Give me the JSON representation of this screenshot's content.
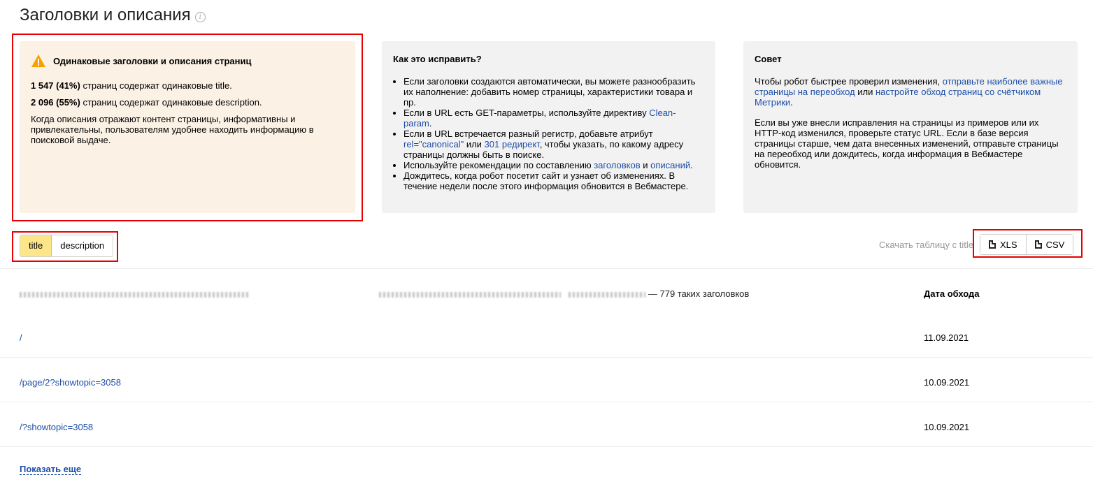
{
  "page": {
    "title": "Заголовки и описания",
    "info_icon": "info-icon"
  },
  "warning_card": {
    "heading": "Одинаковые заголовки и описания страниц",
    "stat1_bold": "1 547 (41%)",
    "stat1_text": " страниц содержат одинаковые title.",
    "stat2_bold": "2 096 (55%)",
    "stat2_text": " страниц содержат одинаковые description.",
    "body": "Когда описания отражают контент страницы, информативны и привлекательны, пользователям удобнее находить информацию в поисковой выдаче."
  },
  "fix_card": {
    "heading": "Как это исправить?",
    "item1": "Если заголовки создаются автоматически, вы можете разнообразить их наполнение: добавить номер страницы, характеристики товара и пр.",
    "item2_pre": "Если в URL есть GET-параметры, используйте директиву ",
    "item2_link": "Clean-param",
    "item2_post": ".",
    "item3_pre": "Если в URL встречается разный регистр, добавьте атрибут ",
    "item3_link1": "rel=\"canonical\"",
    "item3_mid": " или ",
    "item3_link2": "301 редирект",
    "item3_post": ", чтобы указать, по какому адресу страницы должны быть в поиске.",
    "item4_pre": "Используйте рекомендации по составлению ",
    "item4_link1": "заголовков",
    "item4_mid": " и ",
    "item4_link2": "описаний",
    "item4_post": ".",
    "item5": "Дождитесь, когда робот посетит сайт и узнает об изменениях. В течение недели после этого информация обновится в Вебмастере."
  },
  "tip_card": {
    "heading": "Совет",
    "p1_pre": "Чтобы робот быстрее проверил изменения, ",
    "p1_link1": "отправьте наиболее важные страницы на переобход",
    "p1_mid": " или ",
    "p1_link2": "настройте обход страниц со счётчиком Метрики",
    "p1_post": ".",
    "p2": "Если вы уже внесли исправления на страницы из примеров или их HTTP-код изменился, проверьте статус URL. Если в базе версия страницы старше, чем дата внесенных изменений, отправьте страницы на переобход или дождитесь, когда информация в Вебмастере обновится."
  },
  "tabs": [
    {
      "label": "title",
      "active": true
    },
    {
      "label": "description",
      "active": false
    }
  ],
  "download": {
    "label": "Скачать таблицу с title",
    "xls": "XLS",
    "csv": "CSV"
  },
  "table": {
    "group_suffix": "— 779 таких заголовков",
    "date_header": "Дата обхода",
    "rows": [
      {
        "url": "/",
        "date": "11.09.2021"
      },
      {
        "url": "/page/2?showtopic=3058",
        "date": "10.09.2021"
      },
      {
        "url": "/?showtopic=3058",
        "date": "10.09.2021"
      }
    ]
  },
  "show_more": "Показать еще",
  "colors": {
    "accent_red": "#e60000",
    "link": "#1d4ea8",
    "tab_active": "#fde68a",
    "warn_bg": "#fbf1e4",
    "card_bg": "#f2f2f2"
  }
}
